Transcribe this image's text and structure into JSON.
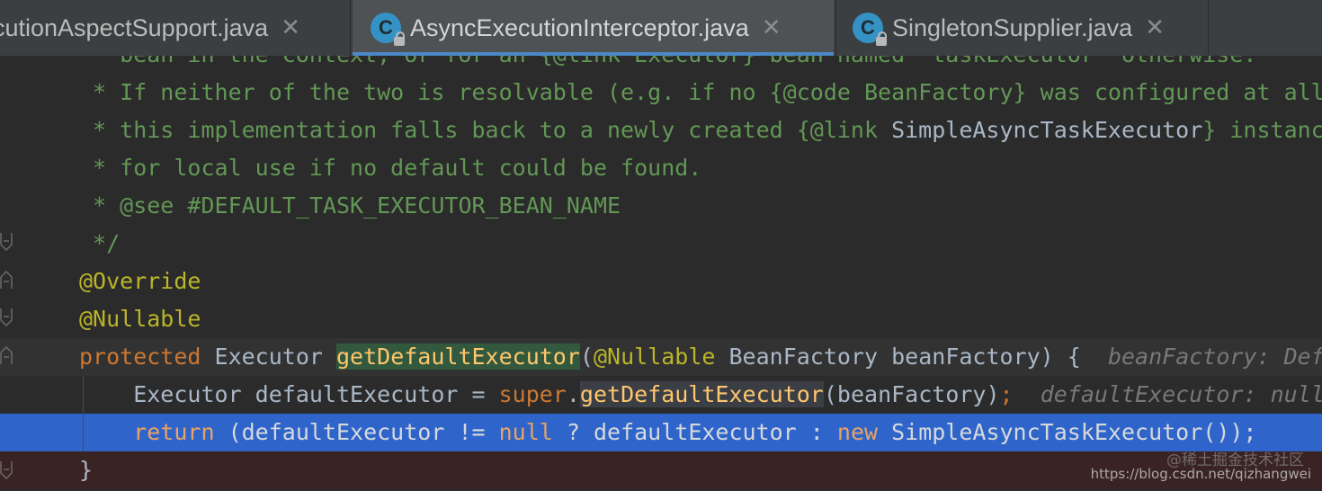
{
  "tabs": [
    {
      "label": "cutionAspectSupport.java",
      "icon": "java-class-icon",
      "active": false
    },
    {
      "label": "AsyncExecutionInterceptor.java",
      "icon": "java-class-icon",
      "icon_letter": "C",
      "active": true
    },
    {
      "label": "SingletonSupplier.java",
      "icon": "java-class-icon",
      "icon_letter": "C",
      "active": false
    }
  ],
  "close_glyph": "✕",
  "code": {
    "l0": {
      "a": " * bean in the context, or for an {@link Executor} bean named \"taskExecutor\" otherwise."
    },
    "l1": {
      "a": " * If neither of the two is resolvable (e.g. if no {@code BeanFactory} was configured at all),"
    },
    "l2": {
      "a": " * this implementation falls back to a newly created {@link ",
      "b": "SimpleAsyncTaskExecutor",
      "c": "} instance"
    },
    "l3": {
      "a": " * for local use if no default could be found."
    },
    "l4": {
      "a": " * ",
      "b": "@see",
      "c": " #DEFAULT_TASK_EXECUTOR_BEAN_NAME"
    },
    "l5": {
      "a": " */"
    },
    "l6": {
      "a": "@Override"
    },
    "l7": {
      "a": "@Nullable"
    },
    "l8": {
      "kw": "protected",
      "type": " Executor ",
      "method": "getDefaultExecutor",
      "open": "(",
      "annot": "@Nullable",
      "param": " BeanFactory beanFactory) {  ",
      "hint": "beanFactory: DefaultListableBeanFactory"
    },
    "l9": {
      "pre": "    Executor defaultExecutor = ",
      "kw": "super",
      "dot": ".",
      "method": "getDefaultExecutor",
      "args": "(beanFactory)",
      "semi": ";",
      "hint": "  defaultExecutor: null"
    },
    "l10": {
      "kw": "    return",
      "p1": " (defaultExecutor != ",
      "nul": "null",
      "p2": " ? defaultExecutor : ",
      "kw2": "new",
      "cls": " SimpleAsyncTaskExecutor",
      "p3": "());"
    },
    "l11": {
      "a": "}"
    }
  },
  "watermark": "https://blog.csdn.net/qizhangwei",
  "watermark_cn": "@稀土掘金技术社区"
}
